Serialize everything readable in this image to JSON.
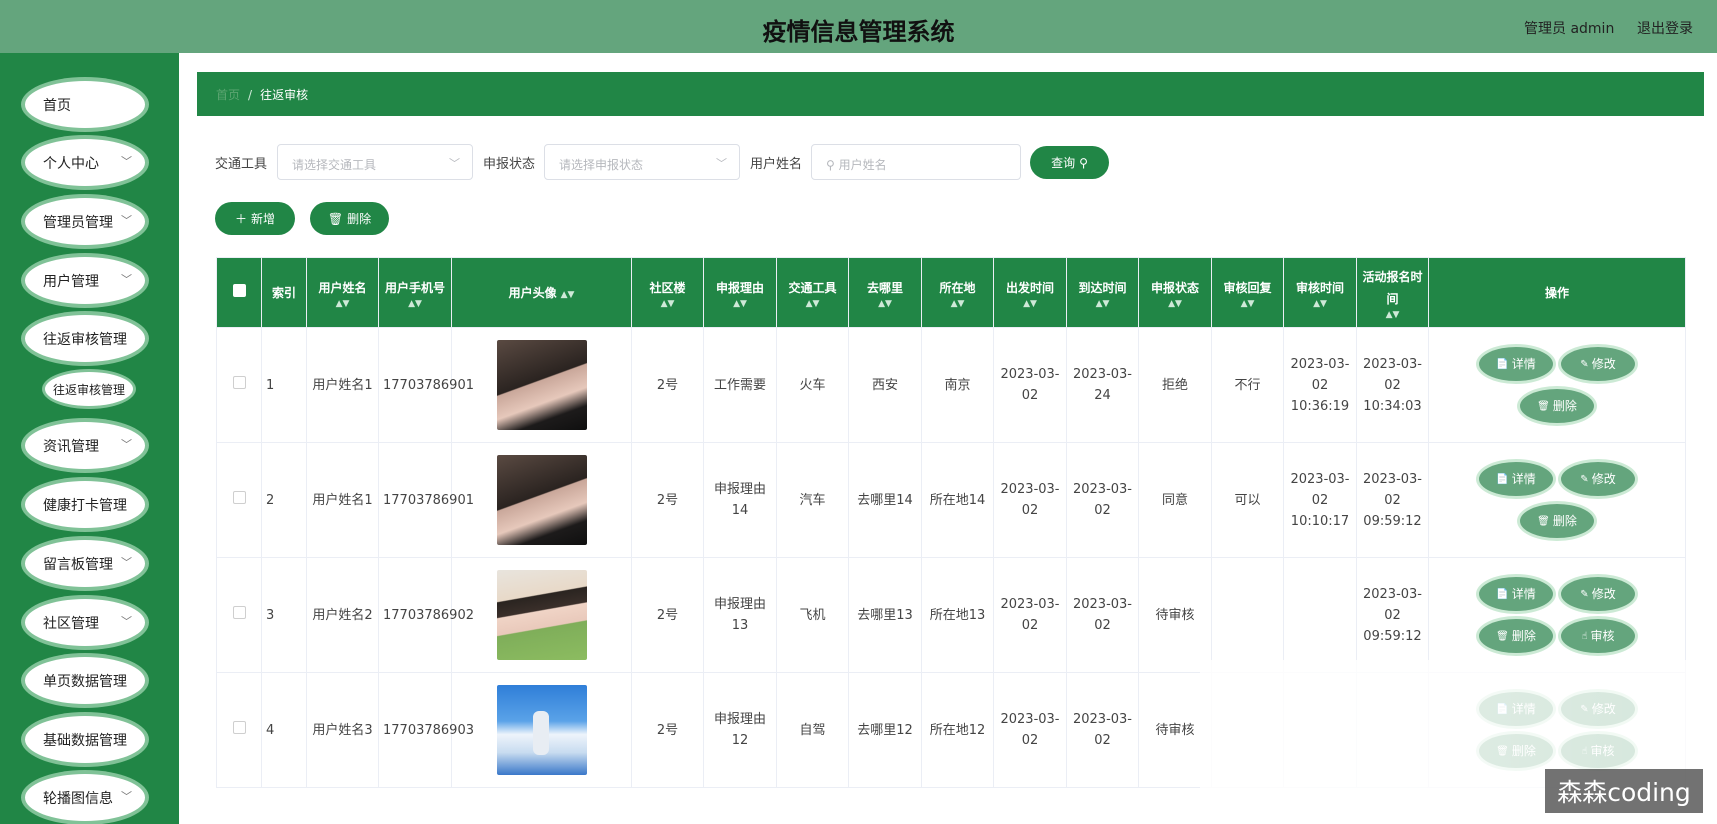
{
  "header": {
    "title": "疫情信息管理系统",
    "user": "管理员 admin",
    "logout": "退出登录"
  },
  "sidebar": {
    "items": [
      {
        "label": "首页",
        "chevron": false
      },
      {
        "label": "个人中心",
        "chevron": true
      },
      {
        "label": "管理员管理",
        "chevron": true
      },
      {
        "label": "用户管理",
        "chevron": true
      },
      {
        "label": "往返审核管理",
        "chevron": false
      },
      {
        "label": "资讯管理",
        "chevron": true
      },
      {
        "label": "健康打卡管理",
        "chevron": false
      },
      {
        "label": "留言板管理",
        "chevron": true
      },
      {
        "label": "社区管理",
        "chevron": true
      },
      {
        "label": "单页数据管理",
        "chevron": false
      },
      {
        "label": "基础数据管理",
        "chevron": false
      },
      {
        "label": "轮播图信息",
        "chevron": true
      }
    ],
    "active_sub": "往返审核管理"
  },
  "breadcrumb": {
    "home": "首页",
    "current": "往返审核"
  },
  "filters": {
    "transport_label": "交通工具",
    "transport_placeholder": "请选择交通工具",
    "status_label": "申报状态",
    "status_placeholder": "请选择申报状态",
    "name_label": "用户姓名",
    "name_placeholder": "用户姓名",
    "query": "查询"
  },
  "actions": {
    "add": "新增",
    "delete": "删除"
  },
  "table": {
    "headers": [
      "索引",
      "用户姓名",
      "用户手机号",
      "用户头像",
      "社区楼",
      "申报理由",
      "交通工具",
      "去哪里",
      "所在地",
      "出发时间",
      "到达时间",
      "申报状态",
      "审核回复",
      "审核时间",
      "活动报名时间",
      "操作"
    ],
    "rows": [
      {
        "index": "1",
        "name": "用户姓名1",
        "phone": "17703786901",
        "avatar": "av-a",
        "building": "2号",
        "reason": "工作需要",
        "transport": "火车",
        "dest": "西安",
        "location": "南京",
        "depart": "2023-03-02",
        "arrive": "2023-03-24",
        "status": "拒绝",
        "reply": "不行",
        "audit_time": "2023-03-02 10:36:19",
        "signup_time": "2023-03-02 10:34:03",
        "can_audit": false
      },
      {
        "index": "2",
        "name": "用户姓名1",
        "phone": "17703786901",
        "avatar": "av-a",
        "building": "2号",
        "reason": "申报理由14",
        "transport": "汽车",
        "dest": "去哪里14",
        "location": "所在地14",
        "depart": "2023-03-02",
        "arrive": "2023-03-02",
        "status": "同意",
        "reply": "可以",
        "audit_time": "2023-03-02 10:10:17",
        "signup_time": "2023-03-02 09:59:12",
        "can_audit": false
      },
      {
        "index": "3",
        "name": "用户姓名2",
        "phone": "17703786902",
        "avatar": "av-b",
        "building": "2号",
        "reason": "申报理由13",
        "transport": "飞机",
        "dest": "去哪里13",
        "location": "所在地13",
        "depart": "2023-03-02",
        "arrive": "2023-03-02",
        "status": "待审核",
        "reply": "",
        "audit_time": "",
        "signup_time": "2023-03-02 09:59:12",
        "can_audit": true
      },
      {
        "index": "4",
        "name": "用户姓名3",
        "phone": "17703786903",
        "avatar": "av-c",
        "building": "2号",
        "reason": "申报理由12",
        "transport": "自驾",
        "dest": "去哪里12",
        "location": "所在地12",
        "depart": "2023-03-02",
        "arrive": "2023-03-02",
        "status": "待审核",
        "reply": "",
        "audit_time": "",
        "signup_time": "",
        "can_audit": true
      }
    ],
    "op_labels": {
      "detail": "详情",
      "edit": "修改",
      "delete": "删除",
      "audit": "审核"
    }
  },
  "watermark": "森森coding"
}
